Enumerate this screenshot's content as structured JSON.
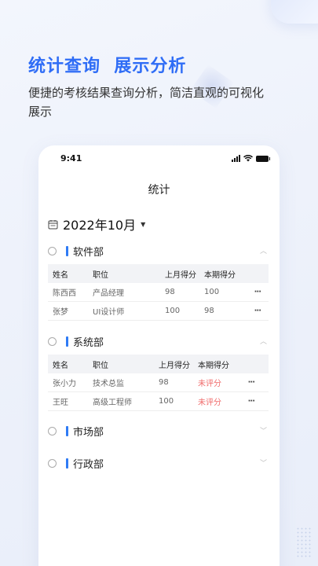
{
  "promo": {
    "headline": "统计查询  展示分析",
    "subline": "便捷的考核结果查询分析，简洁直观的可视化展示"
  },
  "statusbar": {
    "time": "9:41"
  },
  "page": {
    "title": "统计",
    "month": "2022年10月"
  },
  "table_headers": {
    "name": "姓名",
    "position": "职位",
    "last": "上月得分",
    "current": "本期得分"
  },
  "departments": [
    {
      "name": "软件部",
      "expanded": true,
      "rows": [
        {
          "name": "陈西西",
          "position": "产品经理",
          "last": "98",
          "current": "100",
          "more": "···"
        },
        {
          "name": "张梦",
          "position": "UI设计师",
          "last": "100",
          "current": "98",
          "more": "···"
        }
      ]
    },
    {
      "name": "系统部",
      "expanded": true,
      "rows": [
        {
          "name": "张小力",
          "position": "技术总监",
          "last": "98",
          "current": "未评分",
          "more": "···"
        },
        {
          "name": "王旺",
          "position": "高级工程师",
          "last": "100",
          "current": "未评分",
          "more": "···"
        }
      ]
    },
    {
      "name": "市场部",
      "expanded": false
    },
    {
      "name": "行政部",
      "expanded": false
    }
  ],
  "icons": {
    "calendar": "calendar-icon",
    "caret": "caret-down-icon",
    "chevron_up": "chevron-up-icon",
    "chevron_down": "chevron-down-icon"
  },
  "colors": {
    "accent": "#2f6df6",
    "pending": "#f06a6a"
  }
}
